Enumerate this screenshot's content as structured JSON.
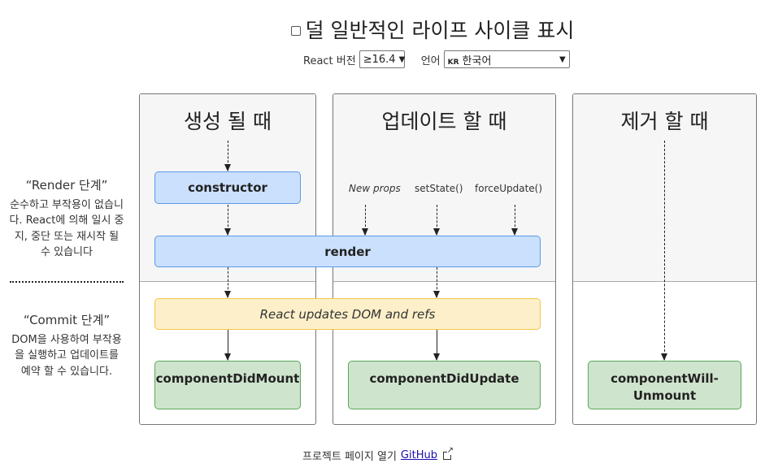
{
  "header": {
    "checkbox_label": "덜 일반적인 라이프 사이클 표시",
    "checkbox_checked": false,
    "react_version_label": "React 버전",
    "react_version_value": "≥16.4",
    "language_label": "언어",
    "language_flag": "KR",
    "language_value": "한국어"
  },
  "phases": {
    "render": {
      "title": "“Render 단계”",
      "description": "순수하고 부작용이 없습니다. React에 의해 일시 중지, 중단 또는 재시작 될 수 있습니다"
    },
    "commit": {
      "title": "“Commit 단계”",
      "description": "DOM을 사용하여 부작용을 실행하고 업데이트를 예약 할 수 있습니다."
    }
  },
  "columns": {
    "mounting": {
      "title": "생성 될 때"
    },
    "updating": {
      "title": "업데이트 할 때"
    },
    "unmounting": {
      "title": "제거 할 때"
    }
  },
  "triggers": {
    "new_props": "New props",
    "set_state": "setState()",
    "force_update": "forceUpdate()"
  },
  "methods": {
    "constructor": "constructor",
    "render": "render",
    "dom_update": "React updates DOM and refs",
    "component_did_mount": "componentDidMount",
    "component_did_update": "componentDidUpdate",
    "component_will_unmount_line1": "componentWill-",
    "component_will_unmount_line2": "Unmount"
  },
  "colors": {
    "render_phase_box": "#cbe0fd",
    "dom_update_box": "#fcefc9",
    "commit_phase_box": "#cfe4cd",
    "render_phase_bg": "#f6f6f6"
  },
  "footer": {
    "text": "프로젝트 페이지 열기",
    "link_label": "GitHub"
  }
}
